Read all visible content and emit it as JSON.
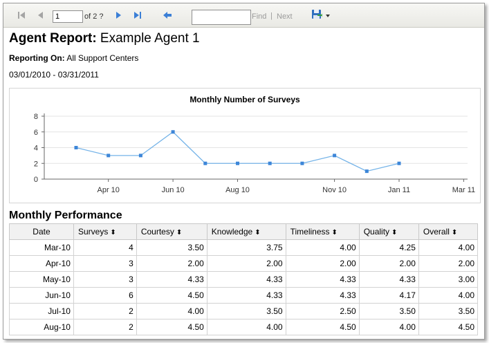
{
  "toolbar": {
    "page_value": "1",
    "page_of": "of 2 ?",
    "find_label": "Find",
    "separator": "|",
    "next_label": "Next",
    "icons": [
      "first-page-icon",
      "previous-page-icon",
      "next-page-icon",
      "last-page-icon",
      "back-icon",
      "export-icon",
      "dropdown-arrow-icon"
    ]
  },
  "report": {
    "title_bold": "Agent Report:",
    "title_rest": " Example Agent 1",
    "reporting_label": "Reporting On:",
    "reporting_value": " All Support Centers",
    "date_range": "03/01/2010 - 03/31/2011"
  },
  "chart_data": {
    "type": "line",
    "title": "Monthly Number of Surveys",
    "x": [
      "Mar-10",
      "Apr-10",
      "May-10",
      "Jun-10",
      "Jul-10",
      "Aug-10",
      "Sep-10",
      "Oct-10",
      "Nov-10",
      "Dec-10",
      "Jan-11",
      "Feb-11"
    ],
    "values": [
      4,
      3,
      3,
      6,
      2,
      2,
      2,
      2,
      3,
      1,
      2,
      null
    ],
    "xticks": [
      "Apr 10",
      "Jun 10",
      "Aug 10",
      "Nov 10",
      "Jan 11",
      "Mar 11"
    ],
    "yticks": [
      "0",
      "2",
      "4",
      "6",
      "8"
    ],
    "ylim": [
      0,
      8
    ],
    "grid": true,
    "color": "#74b3e8"
  },
  "performance": {
    "section_title": "Monthly Performance",
    "columns": [
      "Date",
      "Surveys",
      "Courtesy",
      "Knowledge",
      "Timeliness",
      "Quality",
      "Overall"
    ],
    "sort_icon": "⬍",
    "rows": [
      [
        "Mar-10",
        "4",
        "3.50",
        "3.75",
        "4.00",
        "4.25",
        "4.00"
      ],
      [
        "Apr-10",
        "3",
        "2.00",
        "2.00",
        "2.00",
        "2.00",
        "2.00"
      ],
      [
        "May-10",
        "3",
        "4.33",
        "4.33",
        "4.33",
        "4.33",
        "3.00"
      ],
      [
        "Jun-10",
        "6",
        "4.50",
        "4.33",
        "4.33",
        "4.17",
        "4.00"
      ],
      [
        "Jul-10",
        "2",
        "4.00",
        "3.50",
        "2.50",
        "3.50",
        "3.50"
      ],
      [
        "Aug-10",
        "2",
        "4.50",
        "4.00",
        "4.50",
        "4.00",
        "4.50"
      ]
    ]
  }
}
